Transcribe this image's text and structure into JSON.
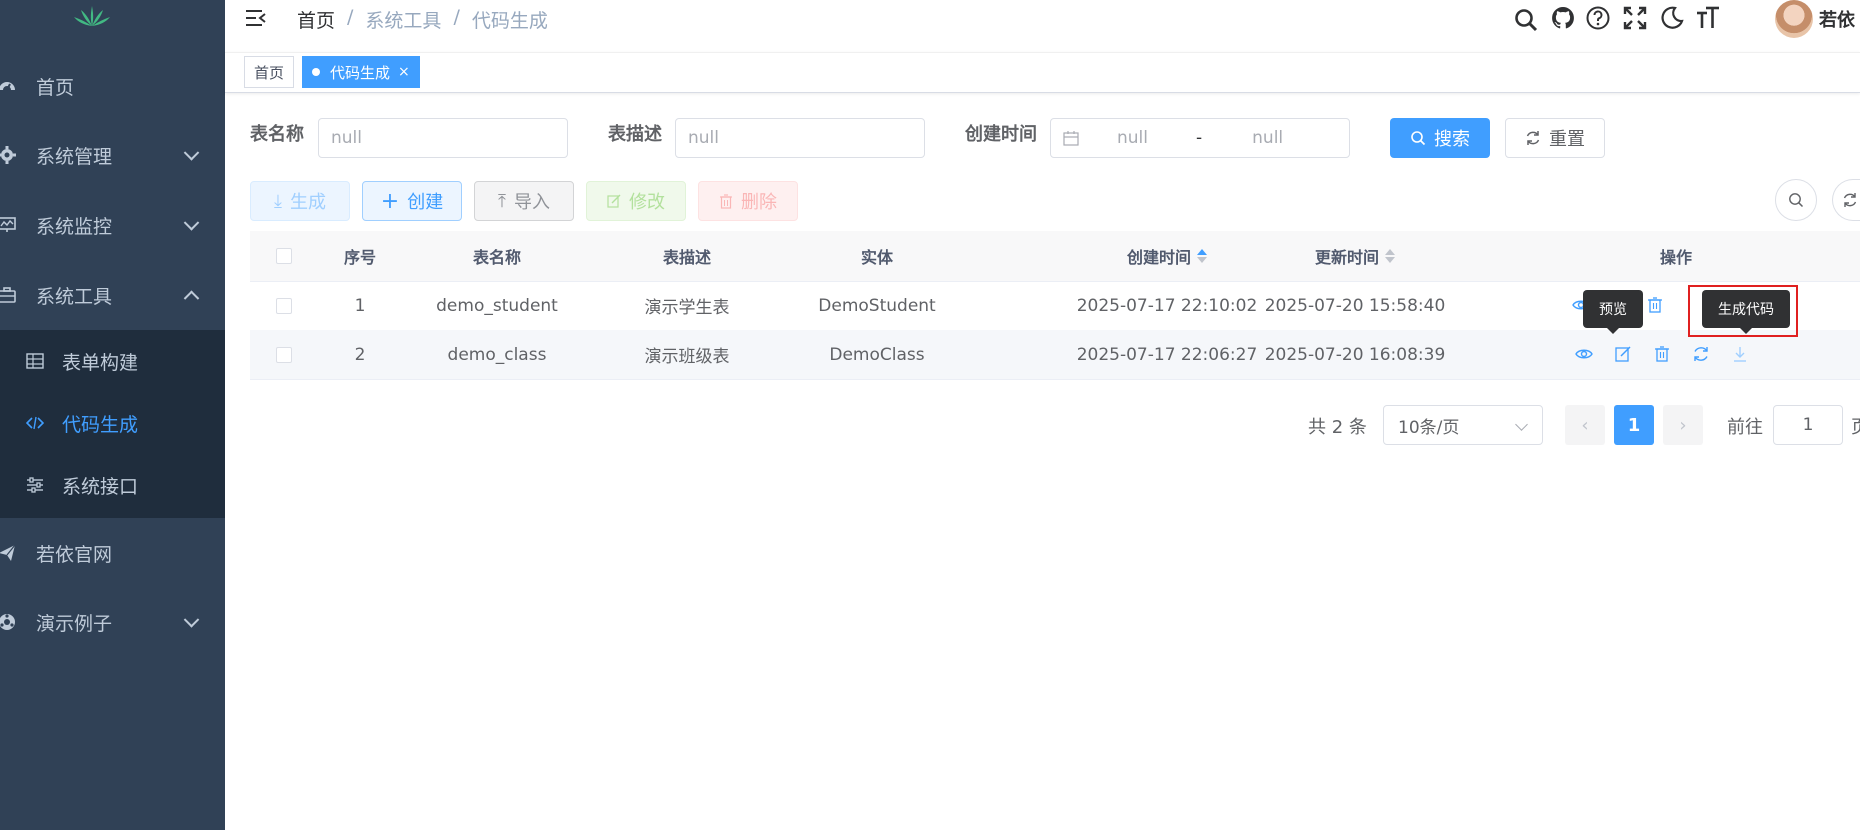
{
  "sidebar": {
    "items": [
      {
        "label": "首页",
        "icon": "dashboard-icon"
      },
      {
        "label": "系统管理",
        "icon": "system-icon"
      },
      {
        "label": "系统监控",
        "icon": "monitor-icon"
      },
      {
        "label": "系统工具",
        "icon": "tool-icon"
      },
      {
        "label": "若依官网",
        "icon": "guide-icon"
      },
      {
        "label": "演示例子",
        "icon": "demo-icon"
      }
    ],
    "subitems": [
      {
        "label": "表单构建",
        "icon": "build-icon"
      },
      {
        "label": "代码生成",
        "icon": "code-icon"
      },
      {
        "label": "系统接口",
        "icon": "swagger-icon"
      }
    ]
  },
  "navbar": {
    "breadcrumb": [
      "首页",
      "系统工具",
      "代码生成"
    ],
    "separator": "/",
    "username": "若依"
  },
  "tags": [
    {
      "label": "首页"
    },
    {
      "label": "代码生成",
      "close": "×"
    }
  ],
  "search": {
    "table_name_label": "表名称",
    "table_name_placeholder": "null",
    "table_comment_label": "表描述",
    "table_comment_placeholder": "null",
    "create_time_label": "创建时间",
    "start_placeholder": "null",
    "range_separator": "-",
    "end_placeholder": "null",
    "search_button": "搜索",
    "reset_button": "重置"
  },
  "toolbar": {
    "generate": "生成",
    "create": "创建",
    "import": "导入",
    "edit": "修改",
    "delete": "删除"
  },
  "table": {
    "columns": [
      "序号",
      "表名称",
      "表描述",
      "实体",
      "创建时间",
      "更新时间",
      "操作"
    ],
    "rows": [
      {
        "index": "1",
        "table_name": "demo_student",
        "table_comment": "演示学生表",
        "class_name": "DemoStudent",
        "create_time": "2025-07-17 22:10:02",
        "update_time": "2025-07-20 15:58:40"
      },
      {
        "index": "2",
        "table_name": "demo_class",
        "table_comment": "演示班级表",
        "class_name": "DemoClass",
        "create_time": "2025-07-17 22:06:27",
        "update_time": "2025-07-20 16:08:39"
      }
    ]
  },
  "tooltips": {
    "preview": "预览",
    "gen_code": "生成代码"
  },
  "pagination": {
    "total": "共 2 条",
    "page_size": "10条/页",
    "current_page": "1",
    "goto_label": "前往",
    "goto_value": "1",
    "page_suffix": "页"
  },
  "colors": {
    "sidebar_bg": "#304156",
    "submenu_bg": "#1f2d3d",
    "primary": "#409eff",
    "success": "#67c23a",
    "danger": "#f56c6c"
  }
}
